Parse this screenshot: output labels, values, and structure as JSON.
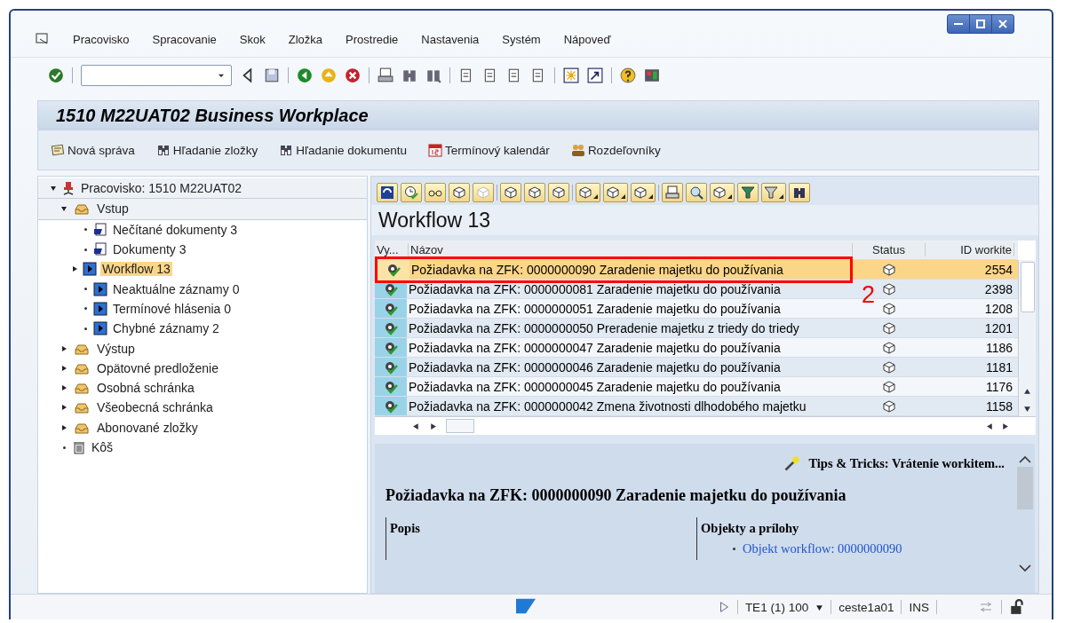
{
  "menu": [
    "Pracovisko",
    "Spracovanie",
    "Skok",
    "Zložka",
    "Prostredie",
    "Nastavenia",
    "Systém",
    "Nápoveď"
  ],
  "title": "1510 M22UAT02 Business Workplace",
  "app_toolbar": [
    {
      "kind": "note",
      "label": "Nová správa"
    },
    {
      "kind": "find",
      "label": "Hľadanie zložky"
    },
    {
      "kind": "find",
      "label": "Hľadanie dokumentu"
    },
    {
      "kind": "calendar",
      "label": "Termínový kalendár"
    },
    {
      "kind": "people",
      "label": "Rozdeľovníky"
    }
  ],
  "tree": {
    "kind": "root",
    "label": "Pracovisko: 1510 M22UAT02",
    "expanded": true,
    "selected": false,
    "children": [
      {
        "kind": "tray",
        "label": "Vstup",
        "expanded": true,
        "selected": false,
        "children": [
          {
            "kind": "document",
            "label": "Nečítané dokumenty 3",
            "selected": false
          },
          {
            "kind": "document",
            "label": "Dokumenty 3",
            "selected": false
          },
          {
            "kind": "workflow",
            "label": "Workflow 13",
            "expanded": false,
            "selected": true
          },
          {
            "kind": "workflow",
            "label": "Neaktuálne záznamy 0",
            "selected": false
          },
          {
            "kind": "workflow",
            "label": "Termínové hlásenia 0",
            "selected": false
          },
          {
            "kind": "workflow",
            "label": "Chybné záznamy 2",
            "selected": false
          }
        ]
      },
      {
        "kind": "tray",
        "label": "Výstup",
        "expanded": false,
        "selected": false
      },
      {
        "kind": "tray",
        "label": "Opätovné predloženie",
        "expanded": false,
        "selected": false
      },
      {
        "kind": "tray",
        "label": "Osobná schránka",
        "expanded": false,
        "selected": false
      },
      {
        "kind": "tray",
        "label": "Všeobecná schránka",
        "expanded": false,
        "selected": false
      },
      {
        "kind": "tray",
        "label": "Abonované zložky",
        "expanded": false,
        "selected": false
      },
      {
        "kind": "trash",
        "label": "Kôš",
        "selected": false
      }
    ]
  },
  "list": {
    "title": "Workflow 13",
    "columns": [
      "Vy...",
      "Názov",
      "Status",
      "ID workite"
    ],
    "rows": [
      {
        "name": "Požiadavka na ZFK: 0000000090 Zaradenie majetku do používania",
        "id": "2554",
        "selected": true,
        "framed": true
      },
      {
        "name": "Požiadavka na ZFK: 0000000081 Zaradenie majetku do používania",
        "id": "2398",
        "selected": false,
        "framed": false
      },
      {
        "name": "Požiadavka na ZFK: 0000000051 Zaradenie majetku do používania",
        "id": "1208",
        "selected": false,
        "framed": false
      },
      {
        "name": "Požiadavka na ZFK: 0000000050 Preradenie majetku z triedy do triedy",
        "id": "1201",
        "selected": false,
        "framed": false
      },
      {
        "name": "Požiadavka na ZFK: 0000000047 Zaradenie majetku do používania",
        "id": "1186",
        "selected": false,
        "framed": false
      },
      {
        "name": "Požiadavka na ZFK: 0000000046 Zaradenie majetku do používania",
        "id": "1181",
        "selected": false,
        "framed": false
      },
      {
        "name": "Požiadavka na ZFK: 0000000045 Zaradenie majetku do používania",
        "id": "1176",
        "selected": false,
        "framed": false
      },
      {
        "name": "Požiadavka na ZFK: 0000000042 Zmena životnosti dlhodobého majetku",
        "id": "1158",
        "selected": false,
        "framed": false
      }
    ]
  },
  "annotation": {
    "label": "2"
  },
  "preview": {
    "tips": "Tips & Tricks:  Vrátenie workitem...",
    "heading": "Požiadavka na ZFK: 0000000090 Zaradenie majetku do používania",
    "columns": [
      "Popis",
      "Objekty a prílohy"
    ],
    "link": "Objekt workflow: 0000000090"
  },
  "status_bar": {
    "system": "TE1 (1) 100",
    "user": "ceste1a01",
    "mode": "INS"
  }
}
